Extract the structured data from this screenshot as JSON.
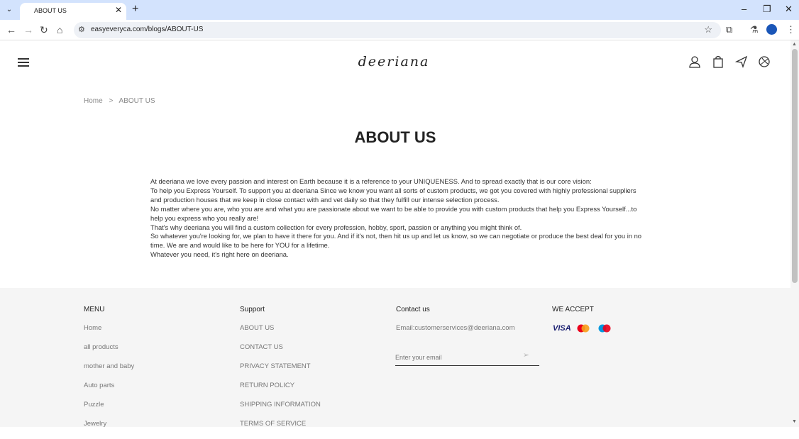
{
  "browser": {
    "tab_title": "ABOUT US",
    "url": "easyeveryca.com/blogs/ABOUT-US"
  },
  "site": {
    "logo": "deeriana"
  },
  "breadcrumb": {
    "home": "Home",
    "separator": ">",
    "current": "ABOUT US"
  },
  "page": {
    "title": "ABOUT US",
    "paragraphs": [
      "At deeriana we love every passion and interest on Earth because it is a reference to your UNIQUENESS. And to spread exactly that is our core vision:",
      "To help you Express Yourself. To support you at deeriana Since we know you want all sorts of custom products, we got you covered with highly professional suppliers and production houses that we keep in close contact with and vet daily so that they fulfill our intense selection process.",
      "No matter where you are, who you are and what you are passionate about we want to be able to provide you with custom products that help you Express Yourself...to help you express who you really are!",
      "That's why deeriana you will find a custom collection for every profession, hobby, sport, passion or anything you might think of.",
      "So whatever you're looking for, we plan to have it there for you. And if it's not, then hit us up and let us know, so we can negotiate or produce the best deal for you in no time. We are and would like to be here for YOU for a lifetime.",
      "Whatever you need, it's right here on deeriana."
    ]
  },
  "footer": {
    "menu": {
      "heading": "MENU",
      "links": [
        "Home",
        "all products",
        "mother and baby",
        "Auto parts",
        "Puzzle",
        "Jewelry"
      ]
    },
    "support": {
      "heading": "Support",
      "links": [
        "ABOUT US",
        "CONTACT US",
        "PRIVACY STATEMENT",
        "RETURN POLICY",
        "SHIPPING INFORMATION",
        "TERMS OF SERVICE"
      ]
    },
    "contact": {
      "heading": "Contact us",
      "email": "Email:customerservices@deeriana.com",
      "input_placeholder": "Enter your email"
    },
    "accept": {
      "heading": "WE ACCEPT",
      "cards": [
        "VISA",
        "mastercard",
        "maestro"
      ]
    }
  },
  "colors": {
    "tabbar": "#d3e3fd",
    "footer_bg": "#f5f5f5",
    "mastercard_red": "#eb001b",
    "mastercard_orange": "#f79e1b",
    "maestro_blue": "#0099df"
  }
}
